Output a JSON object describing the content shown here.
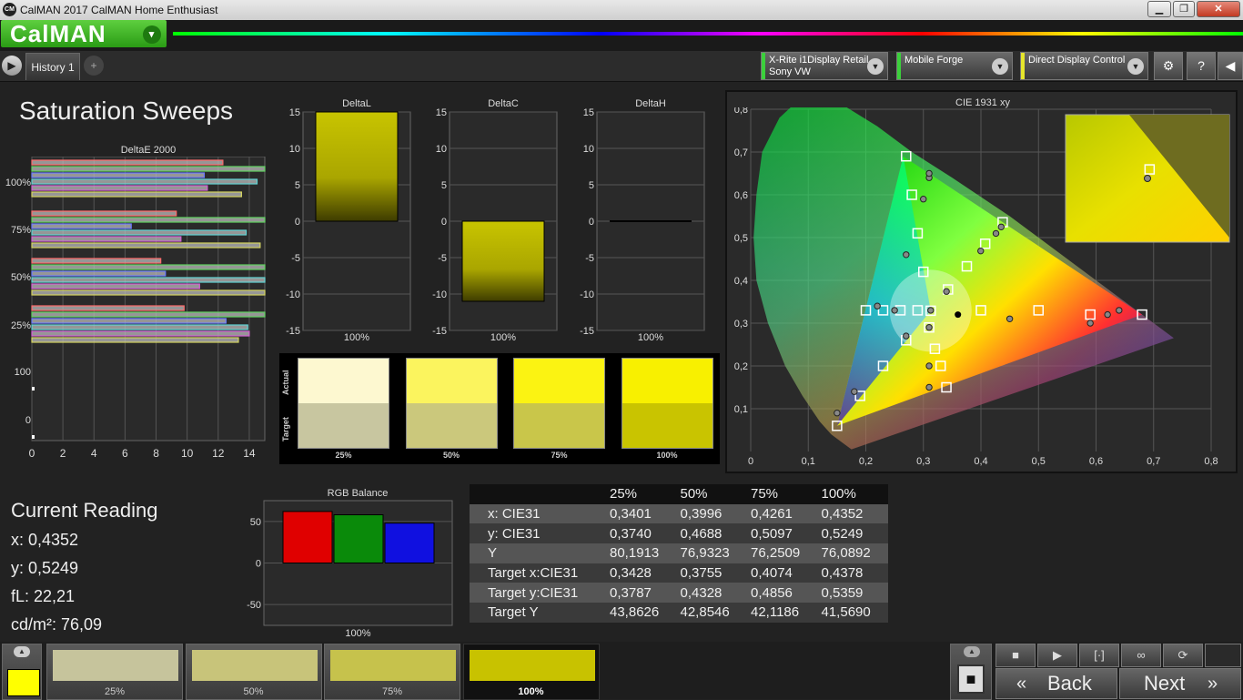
{
  "window": {
    "title": "CalMAN 2017 CalMAN Home Enthusiast",
    "logo": "CM",
    "minimize": "▁",
    "maximize": "❐",
    "close": "✕"
  },
  "brand": {
    "name": "CalMAN",
    "dropdown_icon": "▾"
  },
  "tabs": {
    "history": "History 1",
    "add": "+"
  },
  "devices": [
    {
      "line1": "X-Rite i1Display Retail",
      "line2": "Sony VW",
      "color": "#3bd13b"
    },
    {
      "line1": "Mobile Forge",
      "line2": "",
      "color": "#3bd13b"
    },
    {
      "line1": "Direct Display Control",
      "line2": "",
      "color": "#e6e62c"
    }
  ],
  "toolbar": {
    "settings_icon": "⚙",
    "help_icon": "?",
    "back_icon": "◀",
    "forward_icon": "▶"
  },
  "page_title": "Saturation Sweeps",
  "chart_data": [
    {
      "type": "bar",
      "title": "DeltaE 2000",
      "orientation": "horizontal",
      "xlim": [
        0,
        15
      ],
      "xticks": [
        "0",
        "2",
        "4",
        "6",
        "8",
        "10",
        "12",
        "14"
      ],
      "group_labels": [
        "100%",
        "75%",
        "50%",
        "25%",
        "100",
        "0"
      ],
      "series": [
        {
          "name": "red",
          "color": "#ff6b6b",
          "values": [
            12.3,
            9.3,
            8.3,
            9.8
          ]
        },
        {
          "name": "green",
          "color": "#5fd35f",
          "values": [
            15,
            15,
            15,
            15
          ]
        },
        {
          "name": "blue",
          "color": "#6b7bff",
          "values": [
            11.1,
            6.4,
            8.6,
            12.5
          ]
        },
        {
          "name": "cyan",
          "color": "#5fd3d3",
          "values": [
            14.5,
            13.8,
            15,
            13.9
          ]
        },
        {
          "name": "magenta",
          "color": "#d35fd3",
          "values": [
            11.3,
            9.6,
            10.8,
            14
          ]
        },
        {
          "name": "yellow",
          "color": "#d3d35f",
          "values": [
            13.5,
            14.7,
            15,
            13.3
          ]
        }
      ]
    },
    {
      "type": "bar",
      "title": "DeltaL",
      "categories": [
        "100%"
      ],
      "values": [
        15
      ],
      "ylim": [
        -15,
        15
      ],
      "yticks": [
        "15",
        "10",
        "5",
        "0",
        "-5",
        "-10",
        "-15"
      ]
    },
    {
      "type": "bar",
      "title": "DeltaC",
      "categories": [
        "100%"
      ],
      "values": [
        -11
      ],
      "ylim": [
        -15,
        15
      ],
      "yticks": [
        "15",
        "10",
        "5",
        "0",
        "-5",
        "-10",
        "-15"
      ]
    },
    {
      "type": "bar",
      "title": "DeltaH",
      "categories": [
        "100%"
      ],
      "values": [
        0
      ],
      "ylim": [
        -15,
        15
      ],
      "yticks": [
        "15",
        "10",
        "5",
        "0",
        "-5",
        "-10",
        "-15"
      ]
    },
    {
      "type": "scatter",
      "title": "CIE 1931 xy",
      "xlim": [
        0,
        0.8
      ],
      "ylim": [
        0,
        0.8
      ],
      "xticks": [
        "0",
        "0,1",
        "0,2",
        "0,3",
        "0,4",
        "0,5",
        "0,6",
        "0,7",
        "0,8"
      ],
      "yticks": [
        "0,1",
        "0,2",
        "0,3",
        "0,4",
        "0,5",
        "0,6",
        "0,7",
        "0,8"
      ],
      "targets": [
        [
          0.15,
          0.06
        ],
        [
          0.19,
          0.13
        ],
        [
          0.23,
          0.2
        ],
        [
          0.27,
          0.26
        ],
        [
          0.31,
          0.29
        ],
        [
          0.32,
          0.24
        ],
        [
          0.33,
          0.2
        ],
        [
          0.34,
          0.15
        ],
        [
          0.27,
          0.69
        ],
        [
          0.28,
          0.6
        ],
        [
          0.29,
          0.51
        ],
        [
          0.3,
          0.42
        ],
        [
          0.2,
          0.33
        ],
        [
          0.23,
          0.33
        ],
        [
          0.26,
          0.33
        ],
        [
          0.29,
          0.33
        ],
        [
          0.3127,
          0.329
        ],
        [
          0.3428,
          0.3787
        ],
        [
          0.3755,
          0.4328
        ],
        [
          0.4074,
          0.4856
        ],
        [
          0.4378,
          0.5359
        ],
        [
          0.4,
          0.33
        ],
        [
          0.5,
          0.33
        ],
        [
          0.59,
          0.32
        ],
        [
          0.68,
          0.32
        ]
      ],
      "measured": [
        [
          0.15,
          0.09
        ],
        [
          0.18,
          0.14
        ],
        [
          0.27,
          0.27
        ],
        [
          0.31,
          0.29
        ],
        [
          0.31,
          0.2
        ],
        [
          0.31,
          0.15
        ],
        [
          0.31,
          0.64
        ],
        [
          0.31,
          0.65
        ],
        [
          0.3,
          0.59
        ],
        [
          0.27,
          0.46
        ],
        [
          0.22,
          0.34
        ],
        [
          0.25,
          0.33
        ],
        [
          0.3127,
          0.33
        ],
        [
          0.3401,
          0.374
        ],
        [
          0.3996,
          0.4688
        ],
        [
          0.4261,
          0.5097
        ],
        [
          0.4352,
          0.5249
        ],
        [
          0.45,
          0.31
        ],
        [
          0.59,
          0.3
        ],
        [
          0.62,
          0.32
        ],
        [
          0.64,
          0.33
        ]
      ],
      "current": [
        0.36,
        0.32
      ],
      "inset": {
        "target": [
          0.4378,
          0.5359
        ],
        "measured": [
          0.4352,
          0.5249
        ]
      }
    },
    {
      "type": "bar",
      "title": "RGB Balance",
      "categories": [
        "100%"
      ],
      "series": [
        {
          "name": "R",
          "color": "#e00000",
          "values": [
            62
          ]
        },
        {
          "name": "G",
          "color": "#0a8a0a",
          "values": [
            58
          ]
        },
        {
          "name": "B",
          "color": "#1010e0",
          "values": [
            48
          ]
        }
      ],
      "ylim": [
        -75,
        75
      ],
      "yticks": [
        "50",
        "0",
        "-50"
      ]
    }
  ],
  "swatches": {
    "actual_label": "Actual",
    "target_label": "Target",
    "items": [
      {
        "label": "25%",
        "actual": "#fdf8d0",
        "target": "#c8c6a0"
      },
      {
        "label": "50%",
        "actual": "#fbf45e",
        "target": "#cbc87c"
      },
      {
        "label": "75%",
        "actual": "#fbf312",
        "target": "#c9c64a"
      },
      {
        "label": "100%",
        "actual": "#f8f000",
        "target": "#c9c400"
      }
    ]
  },
  "current_reading": {
    "heading": "Current Reading",
    "x": "x: 0,4352",
    "y": "y: 0,5249",
    "fl": "fL: 22,21",
    "cd": "cd/m²: 76,09"
  },
  "table": {
    "columns": [
      "25%",
      "50%",
      "75%",
      "100%"
    ],
    "rows": [
      {
        "label": "x: CIE31",
        "values": [
          "0,3401",
          "0,3996",
          "0,4261",
          "0,4352"
        ]
      },
      {
        "label": "y: CIE31",
        "values": [
          "0,3740",
          "0,4688",
          "0,5097",
          "0,5249"
        ]
      },
      {
        "label": "Y",
        "values": [
          "80,1913",
          "76,9323",
          "76,2509",
          "76,0892"
        ]
      },
      {
        "label": "Target x:CIE31",
        "values": [
          "0,3428",
          "0,3755",
          "0,4074",
          "0,4378"
        ]
      },
      {
        "label": "Target y:CIE31",
        "values": [
          "0,3787",
          "0,4328",
          "0,4856",
          "0,5359"
        ]
      },
      {
        "label": "Target Y",
        "values": [
          "43,8626",
          "42,8546",
          "42,1186",
          "41,5690"
        ]
      }
    ]
  },
  "steps": [
    {
      "label": "25%",
      "color": "#c6c49c"
    },
    {
      "label": "50%",
      "color": "#c8c47a"
    },
    {
      "label": "75%",
      "color": "#c6c24c"
    },
    {
      "label": "100%",
      "color": "#c8c200"
    }
  ],
  "current_swatch_color": "#ffff00",
  "controls": {
    "up_icon": "▲",
    "stop_icon": "■",
    "play_icon": "▶",
    "measure_icon": "[·]",
    "loop_icon": "∞",
    "refresh_icon": "⟳",
    "back_label": "Back",
    "next_label": "Next",
    "back_icon": "«",
    "next_icon": "»"
  }
}
